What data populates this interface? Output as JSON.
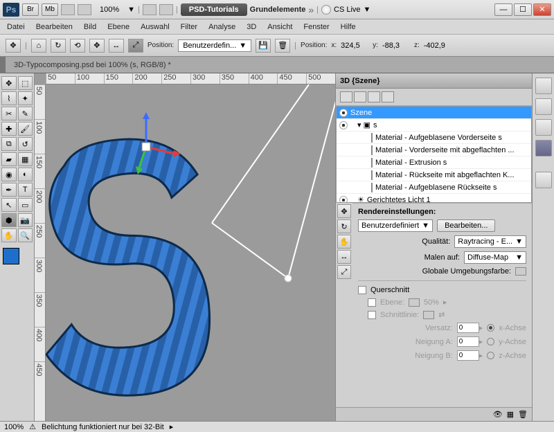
{
  "titlebar": {
    "app_badge": "Ps",
    "btn_br": "Br",
    "btn_mb": "Mb",
    "zoom": "100%",
    "workspace_pill": "PSD-Tutorials",
    "workspace_label": "Grundelemente",
    "cslive": "CS Live"
  },
  "menu": [
    "Datei",
    "Bearbeiten",
    "Bild",
    "Ebene",
    "Auswahl",
    "Filter",
    "Analyse",
    "3D",
    "Ansicht",
    "Fenster",
    "Hilfe"
  ],
  "options": {
    "position_label": "Position:",
    "position_value": "Benutzerdefin...",
    "coords_label": "Position:",
    "x_label": "x:",
    "x_val": "324,5",
    "y_label": "y:",
    "y_val": "-88,3",
    "z_label": "z:",
    "z_val": "-402,9"
  },
  "document_tab": "3D-Typocomposing.psd bei 100% (s, RGB/8) *",
  "ruler_h": [
    "50",
    "100",
    "150",
    "200",
    "250",
    "300",
    "350",
    "400",
    "450",
    "500"
  ],
  "ruler_v": [
    "50",
    "100",
    "150",
    "200",
    "250",
    "300",
    "350",
    "400",
    "450"
  ],
  "swatch_fg": "#1e6fcc",
  "panel3d": {
    "tab": "3D {Szene}",
    "tree": [
      {
        "label": "Szene",
        "selected": true,
        "eye": true
      },
      {
        "label": "s",
        "indent": 1,
        "eye": true,
        "folder": true
      },
      {
        "label": "Material - Aufgeblasene Vorderseite s",
        "indent": 2,
        "mat": true
      },
      {
        "label": "Material - Vorderseite mit abgeflachten ...",
        "indent": 2,
        "mat": true
      },
      {
        "label": "Material - Extrusion s",
        "indent": 2,
        "mat": true
      },
      {
        "label": "Material - Rückseite mit abgeflachten K...",
        "indent": 2,
        "mat": true
      },
      {
        "label": "Material - Aufgeblasene Rückseite s",
        "indent": 2,
        "mat": true
      },
      {
        "label": "Gerichtetes Licht 1",
        "indent": 1,
        "eye": true,
        "light": true
      }
    ],
    "render_title": "Rendereinstellungen:",
    "render_preset": "Benutzerdefiniert",
    "edit_btn": "Bearbeiten...",
    "quality_label": "Qualität:",
    "quality_value": "Raytracing - E...",
    "paint_label": "Malen auf:",
    "paint_value": "Diffuse-Map",
    "global_label": "Globale Umgebungsfarbe:",
    "cross_label": "Querschnitt",
    "plane_label": "Ebene:",
    "plane_pct": "50%",
    "cut_label": "Schnittlinie:",
    "offset_label": "Versatz:",
    "offset_val": "0",
    "tiltA_label": "Neigung A:",
    "tiltA_val": "0",
    "tiltB_label": "Neigung B:",
    "tiltB_val": "0",
    "axis_x": "x-Achse",
    "axis_y": "y-Achse",
    "axis_z": "z-Achse"
  },
  "status": {
    "zoom": "100%",
    "warn": "Belichtung funktioniert nur bei 32-Bit"
  }
}
